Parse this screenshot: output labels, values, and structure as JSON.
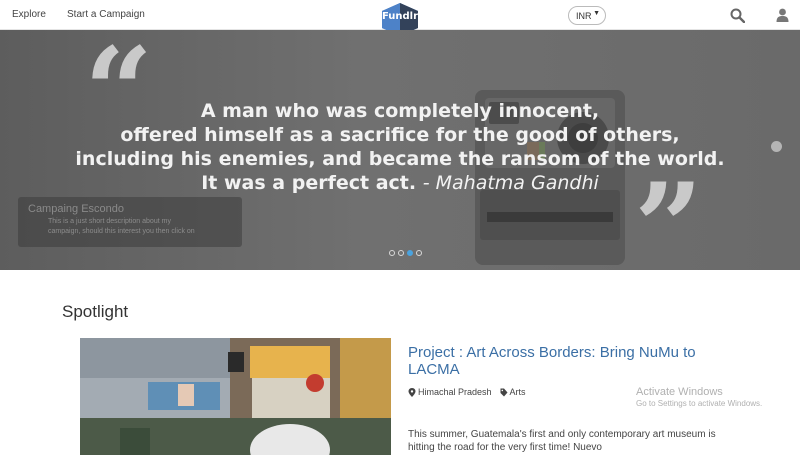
{
  "nav": {
    "explore": "Explore",
    "start_campaign": "Start a Campaign",
    "logo_text": "Fundlr",
    "currency": "INR",
    "search_icon": "search-icon",
    "user_icon": "user-icon"
  },
  "hero": {
    "quote_lines": [
      "A man who was completely innocent,",
      "offered himself as a sacrifice for the good of others,",
      "including his enemies, and became the ransom of the world.",
      "It was a perfect act."
    ],
    "quote_author": "- Mahatma Gandhi",
    "campaign_title": "Campaing Escondo",
    "campaign_desc_1": "This is a just short description about my",
    "campaign_desc_2": "campaign, should this interest you then click on",
    "slides_total": 4,
    "active_slide": 3,
    "colors": {
      "overlay": "#6e6e6e",
      "quote_text": "#f2f2f2",
      "active_dot": "#4aa3df"
    }
  },
  "spotlight": {
    "heading": "Spotlight",
    "project_title": "Project : Art Across Borders: Bring NuMu to LACMA",
    "location": "Himachal Pradesh",
    "category": "Arts",
    "excerpt": "This summer, Guatemala's first and only contemporary art museum is hitting the road for the very first time! Nuevo",
    "colors": {
      "title_link": "#3b6fa5"
    }
  },
  "os_watermark": {
    "title": "Activate Windows",
    "subtitle": "Go to Settings to activate Windows."
  }
}
